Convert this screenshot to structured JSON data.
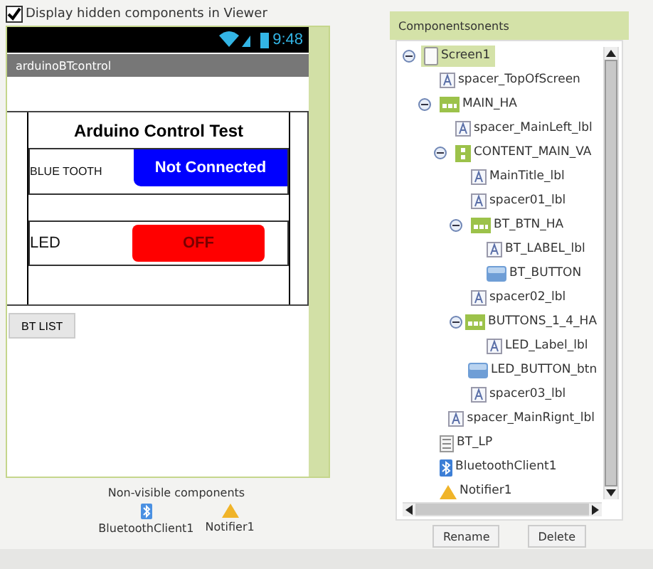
{
  "viewer": {
    "hidden_checkbox": {
      "label": "Display hidden components in Viewer",
      "checked": true
    }
  },
  "phone": {
    "time": "9:48",
    "title": "arduinoBTcontrol",
    "heading": "Arduino Control Test",
    "rows": [
      {
        "kind": "status",
        "label": "BLUE TOOTH",
        "button": "Not Connected",
        "color": "#0000ff"
      },
      {
        "kind": "toggle",
        "label": "LED",
        "button": "OFF",
        "color": "#ff0000"
      }
    ],
    "bt_list_button": "BT LIST"
  },
  "non_visible": {
    "title": "Non-visible components",
    "items": [
      {
        "kind": "bluetooth",
        "label": "BluetoothClient1"
      },
      {
        "kind": "notifier",
        "label": "Notifier1"
      }
    ]
  },
  "components": {
    "title": "Componentsonents",
    "tree": [
      {
        "name": "Screen1",
        "kind": "screen",
        "selected": true,
        "expanded": true,
        "children": [
          {
            "name": "spacer_TopOfScreen",
            "kind": "label",
            "selected": false
          },
          {
            "name": "MAIN_HA",
            "kind": "hbox",
            "selected": false,
            "expanded": true,
            "children": [
              {
                "name": "spacer_MainLeft_lbl",
                "kind": "label",
                "selected": false
              },
              {
                "name": "CONTENT_MAIN_VA",
                "kind": "vbox",
                "selected": false,
                "expanded": true,
                "children": [
                  {
                    "name": "MainTitle_lbl",
                    "kind": "label",
                    "selected": false
                  },
                  {
                    "name": "spacer01_lbl",
                    "kind": "label",
                    "selected": false
                  },
                  {
                    "name": "BT_BTN_HA",
                    "kind": "hbox",
                    "selected": false,
                    "expanded": true,
                    "children": [
                      {
                        "name": "BT_LABEL_lbl",
                        "kind": "label",
                        "selected": false
                      },
                      {
                        "name": "BT_BUTTON",
                        "kind": "button",
                        "selected": false
                      }
                    ]
                  },
                  {
                    "name": "spacer02_lbl",
                    "kind": "label",
                    "selected": false
                  },
                  {
                    "name": "BUTTONS_1_4_HA",
                    "kind": "hbox",
                    "selected": false,
                    "expanded": true,
                    "children": [
                      {
                        "name": "LED_Label_lbl",
                        "kind": "label",
                        "selected": false
                      },
                      {
                        "name": "LED_BUTTON_btn",
                        "kind": "button",
                        "selected": false
                      }
                    ]
                  },
                  {
                    "name": "spacer03_lbl",
                    "kind": "label",
                    "selected": false
                  }
                ]
              },
              {
                "name": "spacer_MainRignt_lbl",
                "kind": "label",
                "selected": false
              }
            ]
          },
          {
            "name": "BT_LP",
            "kind": "list",
            "selected": false
          },
          {
            "name": "BluetoothClient1",
            "kind": "bluetooth",
            "selected": false
          },
          {
            "name": "Notifier1",
            "kind": "notifier",
            "selected": false
          }
        ]
      }
    ],
    "buttons": [
      "Rename",
      "Delete"
    ]
  }
}
